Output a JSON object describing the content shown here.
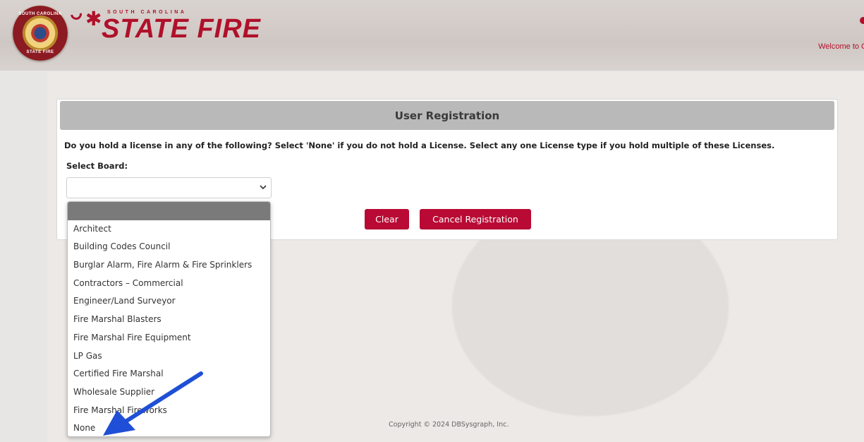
{
  "header": {
    "badge_top": "SOUTH CAROLINA",
    "badge_bottom": "STATE FIRE",
    "brand_small": "SOUTH CAROLINA",
    "brand_big": "STATE FIRE",
    "welcome": "Welcome to C"
  },
  "registration": {
    "title": "User Registration",
    "question": "Do you hold a license in any of the following? Select 'None' if you do not hold a License. Select any one License type if you hold multiple of these Licenses.",
    "select_label": "Select Board:",
    "select_value": "",
    "clear_label": "Clear",
    "cancel_label": "Cancel Registration"
  },
  "dropdown": {
    "options": [
      "",
      "Architect",
      "Building Codes Council",
      "Burglar Alarm, Fire Alarm & Fire Sprinklers",
      "Contractors – Commercial",
      "Engineer/Land Surveyor",
      "Fire Marshal Blasters",
      "Fire Marshal Fire Equipment",
      "LP Gas",
      "Certified Fire Marshal",
      "Wholesale Supplier",
      "Fire Marshal Fireworks",
      "None"
    ]
  },
  "footer": {
    "copyright": "Copyright © 2024 DBSysgraph, Inc."
  },
  "colors": {
    "brand": "#b0102a",
    "button": "#b80a34",
    "header_bar": "#b9b9b9",
    "arrow": "#1f4fd6"
  }
}
